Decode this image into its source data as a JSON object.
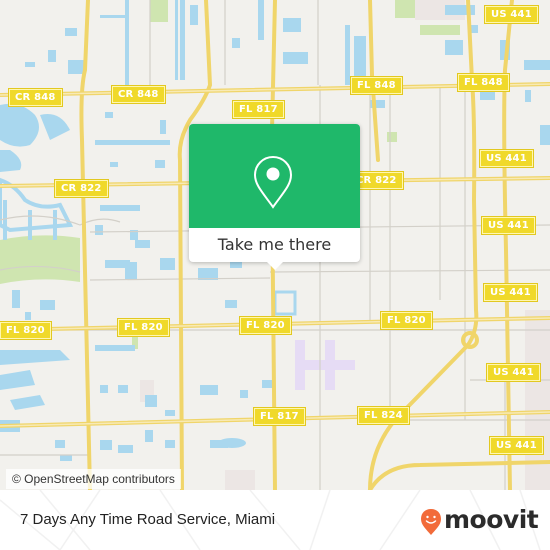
{
  "map": {
    "road_labels": [
      {
        "id": "us441-a",
        "text": "US 441"
      },
      {
        "id": "cr848-a",
        "text": "CR 848"
      },
      {
        "id": "cr848-b",
        "text": "CR 848"
      },
      {
        "id": "fl848-a",
        "text": "FL 848"
      },
      {
        "id": "fl848-b",
        "text": "FL 848"
      },
      {
        "id": "fl817-a",
        "text": "FL 817"
      },
      {
        "id": "cr822-a",
        "text": "CR 822"
      },
      {
        "id": "cr822-b",
        "text": "CR 822"
      },
      {
        "id": "us441-b",
        "text": "US 441"
      },
      {
        "id": "us441-c",
        "text": "US 441"
      },
      {
        "id": "us441-d",
        "text": "US 441"
      },
      {
        "id": "fl820-a",
        "text": "FL 820"
      },
      {
        "id": "fl820-b",
        "text": "FL 820"
      },
      {
        "id": "fl820-c",
        "text": "FL 820"
      },
      {
        "id": "fl820-d",
        "text": "FL 820"
      },
      {
        "id": "us441-e",
        "text": "US 441"
      },
      {
        "id": "fl817-b",
        "text": "FL 817"
      },
      {
        "id": "fl824-a",
        "text": "FL 824"
      },
      {
        "id": "us441-f",
        "text": "US 441"
      }
    ],
    "attribution": "© OpenStreetMap contributors",
    "colors": {
      "land": "#f2f1ed",
      "water": "#a9d7ee",
      "major_road": "#f5e27a",
      "minor_road": "#d3d0c9",
      "park": "#cfe5b0",
      "popup_green": "#1fb86a"
    }
  },
  "popup": {
    "icon": "map-pin-icon",
    "button_label": "Take me there"
  },
  "footer": {
    "place_name": "7 Days Any Time Road Service, Miami",
    "brand": "moovit",
    "brand_color": "#f26b3a"
  }
}
